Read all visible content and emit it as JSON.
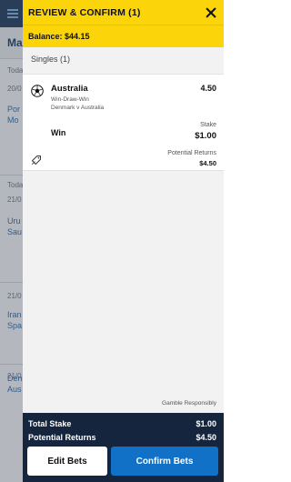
{
  "background": {
    "heading": "Ma",
    "cards": [
      {
        "top": "Toda",
        "line1": "20/0",
        "line2": "Por",
        "line3": "Mo"
      },
      {
        "top": "Toda",
        "line1": "21/0",
        "line2": "Uru",
        "line3": "Sau"
      },
      {
        "top": "",
        "line1": "21/0",
        "line2": "Iran",
        "line3": "Spa"
      },
      {
        "top": "",
        "line1": "21/0",
        "line2": "Den",
        "line3": "Aus"
      }
    ]
  },
  "slip": {
    "title": "REVIEW & CONFIRM (1)",
    "balance": "Balance: $44.15",
    "section_label": "Singles (1)",
    "bet": {
      "selection": "Australia",
      "odds": "4.50",
      "market": "Win-Draw-Win",
      "event": "Denmark v Australia",
      "bet_type": "Win",
      "stake_label": "Stake",
      "stake": "$1.00",
      "returns_label": "Potential Returns",
      "returns": "$4.50",
      "icons": [
        "football-icon",
        "tag-icon"
      ]
    },
    "gamble_note": "Gamble Responsibly",
    "totals": {
      "stake_label": "Total Stake",
      "stake": "$1.00",
      "returns_label": "Potential Returns",
      "returns": "$4.50"
    },
    "buttons": {
      "edit": "Edit Bets",
      "confirm": "Confirm Bets"
    }
  },
  "colors": {
    "header_yellow": "#fbd40a",
    "footer_navy": "#14253d",
    "confirm_blue": "#1171c6"
  }
}
